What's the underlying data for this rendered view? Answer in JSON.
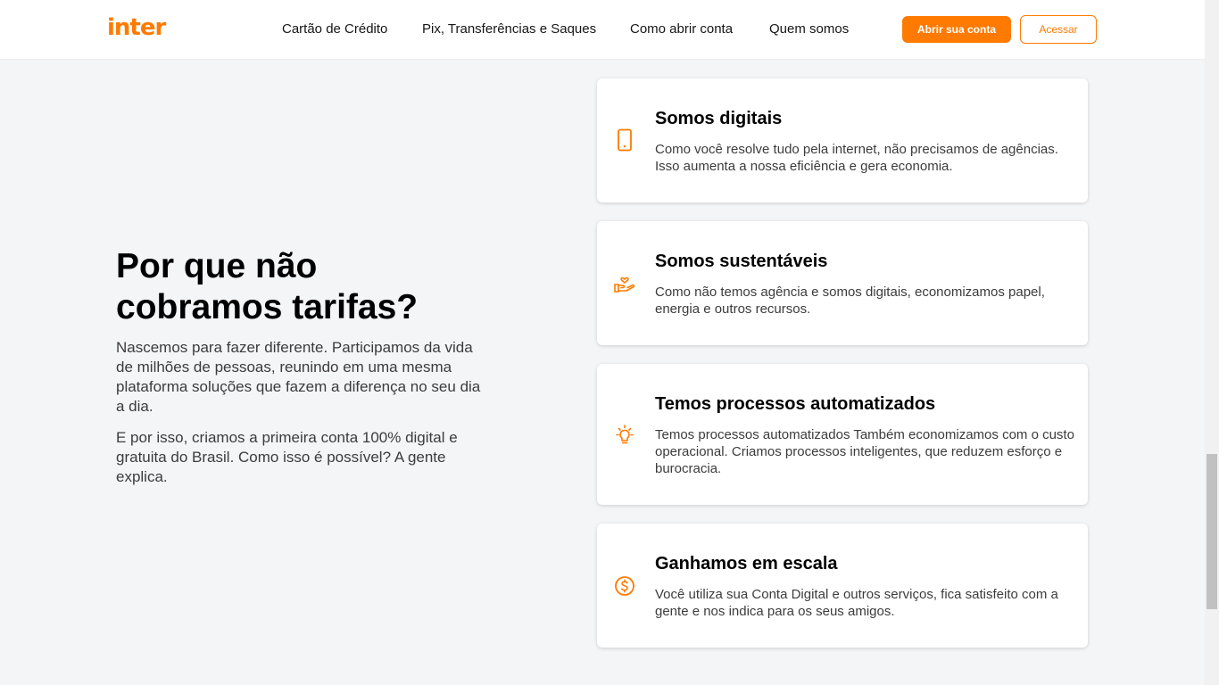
{
  "header": {
    "logo": "inter",
    "nav": [
      "Cartão de Crédito",
      "Pix, Transferências e Saques",
      "Como abrir conta",
      "Quem somos"
    ],
    "primary_button": "Abrir sua conta",
    "secondary_button": "Acessar"
  },
  "main": {
    "headline": "Por que não cobramos tarifas?",
    "paragraphs": [
      "Nascemos para fazer diferente. Participamos da vida de milhões de pessoas, reunindo em uma mesma plataforma soluções que fazem a diferença no seu dia a dia.",
      "E por isso, criamos a primeira conta 100% digital e gratuita do Brasil. Como isso é possível? A gente explica."
    ]
  },
  "cards": [
    {
      "icon": "smartphone-icon",
      "title": "Somos digitais",
      "text": "Como você resolve tudo pela internet, não precisamos de agências. Isso aumenta a nossa eficiência e gera economia."
    },
    {
      "icon": "hand-heart-icon",
      "title": "Somos sustentáveis",
      "text": "Como não temos agência e somos digitais, economizamos papel, energia e outros recursos."
    },
    {
      "icon": "lightbulb-icon",
      "title": "Temos processos automatizados",
      "text": "Temos processos automatizados Também economizamos com o custo operacional. Criamos processos inteligentes, que reduzem esforço e burocracia."
    },
    {
      "icon": "dollar-coin-icon",
      "title": "Ganhamos em escala",
      "text": "Você utiliza sua Conta Digital e outros serviços, fica satisfeito com a gente e nos indica para os seus amigos."
    }
  ],
  "colors": {
    "brand": "#ff7a00",
    "background": "#f4f5f7",
    "card": "#ffffff"
  }
}
